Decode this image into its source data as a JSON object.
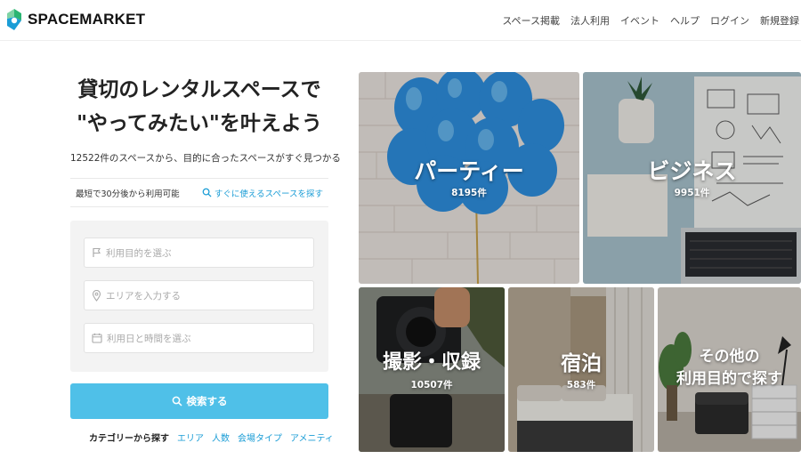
{
  "brand": {
    "name": "SPACEMARKET",
    "color_green": "#2bb573",
    "color_blue": "#1b9dd6"
  },
  "nav": {
    "items": [
      "スペース掲載",
      "法人利用",
      "イベント",
      "ヘルプ",
      "ログイン",
      "新規登録"
    ]
  },
  "hero": {
    "title_line1": "貸切のレンタルスペースで",
    "title_line2": "\"やってみたい\"を叶えよう",
    "subtitle": "12522件のスペースから、目的に合ったスペースがすぐ見つかる"
  },
  "quick": {
    "left_text": "最短で30分後から利用可能",
    "link_text": "すぐに使えるスペースを探す",
    "icon": "search-icon"
  },
  "search": {
    "purpose_placeholder": "利用目的を選ぶ",
    "purpose_icon": "flag-icon",
    "area_placeholder": "エリアを入力する",
    "area_icon": "location-pin-icon",
    "date_placeholder": "利用日と時間を選ぶ",
    "date_icon": "calendar-icon",
    "button_label": "検索する",
    "button_color": "#4fc0e8"
  },
  "category_links": {
    "label": "カテゴリーから探す",
    "links": [
      "エリア",
      "人数",
      "会場タイプ",
      "アメニティ"
    ]
  },
  "tiles": {
    "party": {
      "name": "パーティー",
      "count": "8195件"
    },
    "business": {
      "name": "ビジネス",
      "count": "9951件"
    },
    "photo": {
      "name": "撮影・収録",
      "count": "10507件"
    },
    "stay": {
      "name": "宿泊",
      "count": "583件"
    },
    "other": {
      "name_line1": "その他の",
      "name_line2": "利用目的で探す"
    }
  }
}
